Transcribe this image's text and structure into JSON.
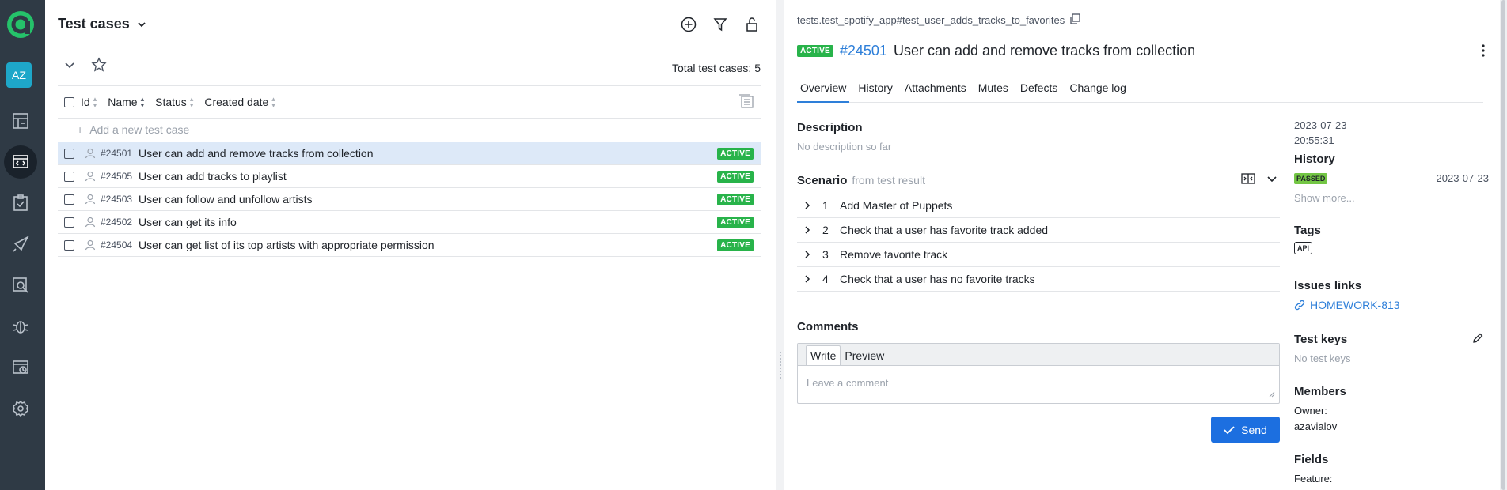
{
  "nav": {
    "avatar": "AZ",
    "items": [
      "dashboards-icon",
      "test-cases-icon",
      "test-plans-icon",
      "launches-icon",
      "analytics-icon",
      "defects-icon",
      "jobs-icon",
      "settings-icon"
    ]
  },
  "left": {
    "title": "Test cases",
    "total": "Total test cases: 5",
    "columns": [
      "Id",
      "Name",
      "Status",
      "Created date"
    ],
    "add_label": "Add a new test case",
    "rows": [
      {
        "id": "#24501",
        "name": "User can add and remove tracks from collection",
        "status": "ACTIVE"
      },
      {
        "id": "#24505",
        "name": "User can add tracks to playlist",
        "status": "ACTIVE"
      },
      {
        "id": "#24503",
        "name": "User can follow and unfollow artists",
        "status": "ACTIVE"
      },
      {
        "id": "#24502",
        "name": "User can get its info",
        "status": "ACTIVE"
      },
      {
        "id": "#24504",
        "name": "User can get list of its top artists with appropriate permission",
        "status": "ACTIVE"
      }
    ]
  },
  "detail": {
    "path": "tests.test_spotify_app#test_user_adds_tracks_to_favorites",
    "status": "ACTIVE",
    "id": "#24501",
    "title": "User can add and remove tracks from collection",
    "tabs": [
      "Overview",
      "History",
      "Attachments",
      "Mutes",
      "Defects",
      "Change log"
    ],
    "description_h": "Description",
    "description": "No description so far",
    "scenario_h": "Scenario",
    "scenario_from": "from test result",
    "steps": [
      {
        "n": "1",
        "text": "Add Master of Puppets"
      },
      {
        "n": "2",
        "text": "Check that a user has favorite track added"
      },
      {
        "n": "3",
        "text": "Remove favorite track"
      },
      {
        "n": "4",
        "text": "Check that a user has no favorite tracks"
      }
    ],
    "comments_h": "Comments",
    "write_tab": "Write",
    "preview_tab": "Preview",
    "comment_placeholder": "Leave a comment",
    "send": "Send"
  },
  "side": {
    "created_date": "2023-07-23",
    "created_time": "20:55:31",
    "history_h": "History",
    "history_status": "PASSED",
    "history_date": "2023-07-23",
    "show_more": "Show more...",
    "tags_h": "Tags",
    "tag": "API",
    "issues_h": "Issues links",
    "issue": "HOMEWORK-813",
    "keys_h": "Test keys",
    "keys": "No test keys",
    "members_h": "Members",
    "owner_label": "Owner:",
    "owner": "azavialov",
    "fields_h": "Fields",
    "feature_label": "Feature:"
  },
  "colors": {
    "nav_bg": "#2f3a45",
    "accent": "#2e7fd9",
    "active_badge": "#28b34a",
    "passed_badge": "#73c644",
    "selected_row": "#dde9f8",
    "send_button": "#1c6fe0"
  }
}
